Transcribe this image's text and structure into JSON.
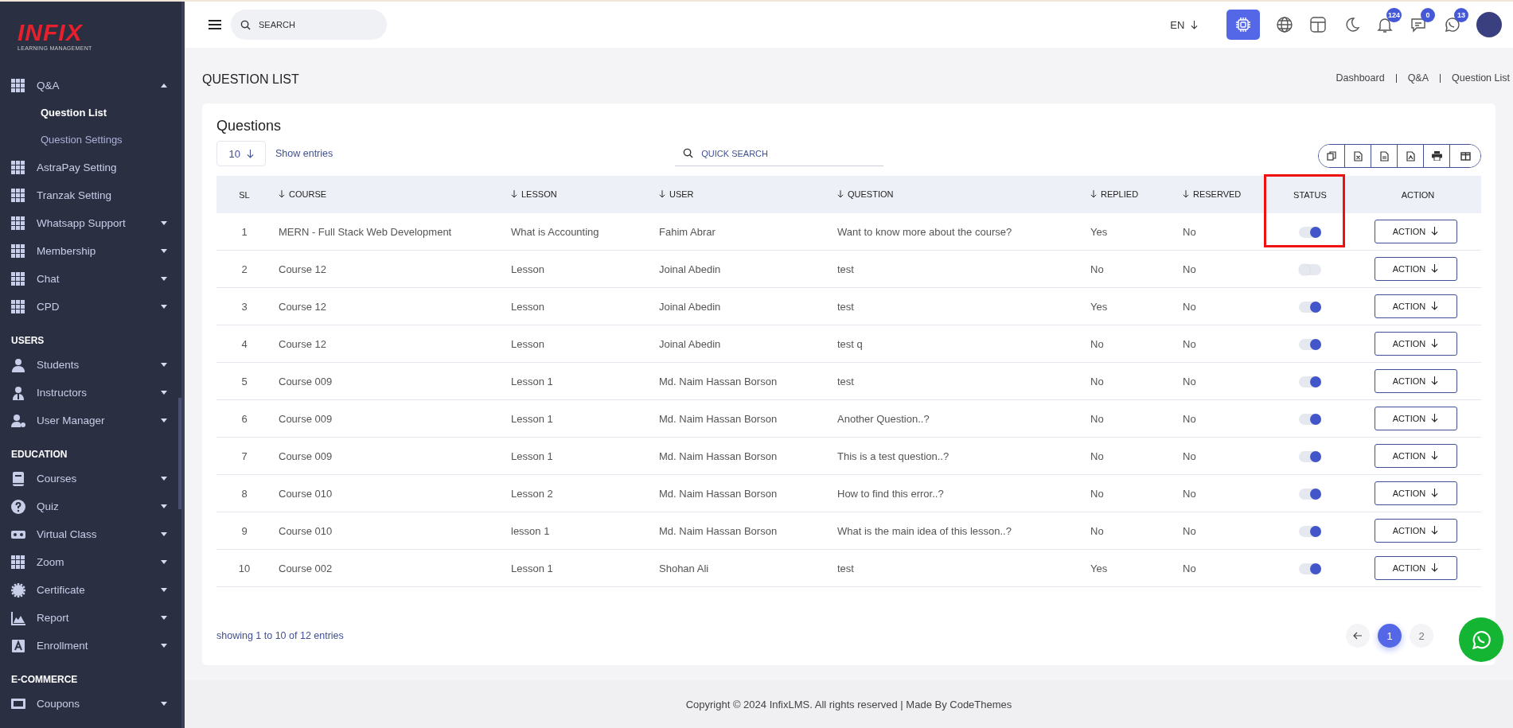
{
  "logo": {
    "text": "INFIX",
    "subtitle": "LEARNING MANAGEMENT"
  },
  "sidebar": {
    "sections": [
      {
        "items": [
          {
            "label": "Q&A",
            "kind": "grid",
            "expanded": true,
            "children": [
              {
                "label": "Question List",
                "selected": true
              },
              {
                "label": "Question Settings",
                "selected": false
              }
            ]
          },
          {
            "label": "AstraPay Setting",
            "kind": "grid"
          },
          {
            "label": "Tranzak Setting",
            "kind": "grid"
          },
          {
            "label": "Whatsapp Support",
            "kind": "grid",
            "expanded": false
          },
          {
            "label": "Membership",
            "kind": "grid",
            "expanded": false
          },
          {
            "label": "Chat",
            "kind": "grid",
            "expanded": false
          },
          {
            "label": "CPD",
            "kind": "grid",
            "expanded": false
          }
        ]
      },
      {
        "heading": "USERS",
        "items": [
          {
            "label": "Students",
            "kind": "user",
            "expanded": false
          },
          {
            "label": "Instructors",
            "kind": "instructor",
            "expanded": false
          },
          {
            "label": "User Manager",
            "kind": "usergear",
            "expanded": false
          }
        ]
      },
      {
        "heading": "EDUCATION",
        "items": [
          {
            "label": "Courses",
            "kind": "book",
            "expanded": false
          },
          {
            "label": "Quiz",
            "kind": "question",
            "expanded": false
          },
          {
            "label": "Virtual Class",
            "kind": "vr",
            "expanded": false
          },
          {
            "label": "Zoom",
            "kind": "grid",
            "expanded": false
          },
          {
            "label": "Certificate",
            "kind": "badge",
            "expanded": false
          },
          {
            "label": "Report",
            "kind": "chart",
            "expanded": false
          },
          {
            "label": "Enrollment",
            "kind": "letter",
            "expanded": false
          }
        ]
      },
      {
        "heading": "E-COMMERCE",
        "items": [
          {
            "label": "Coupons",
            "kind": "screen",
            "expanded": false
          }
        ]
      }
    ]
  },
  "header": {
    "search_placeholder": "SEARCH",
    "language": "EN",
    "notifications": "124",
    "messages": "0",
    "whatsapp": "13"
  },
  "page_title": "QUESTION LIST",
  "breadcrumb": [
    "Dashboard",
    "Q&A",
    "Question List"
  ],
  "card": {
    "title": "Questions",
    "page_size": "10",
    "show_entries": "Show entries",
    "quick_search_placeholder": "QUICK SEARCH"
  },
  "table": {
    "status_highlighted": true,
    "columns": [
      {
        "label": "SL",
        "sortable": false
      },
      {
        "label": "COURSE",
        "sortable": true
      },
      {
        "label": "LESSON",
        "sortable": true
      },
      {
        "label": "USER",
        "sortable": true
      },
      {
        "label": "QUESTION",
        "sortable": true
      },
      {
        "label": "REPLIED",
        "sortable": true
      },
      {
        "label": "RESERVED",
        "sortable": true
      },
      {
        "label": "STATUS",
        "sortable": false
      },
      {
        "label": "ACTION",
        "sortable": false
      }
    ],
    "rows": [
      {
        "sl": "1",
        "course": "MERN - Full Stack Web Development",
        "lesson": "What is Accounting",
        "user": "Fahim Abrar",
        "question": "Want to know more about the course?",
        "replied": "Yes",
        "reserved": "No",
        "status": true,
        "action": "ACTION"
      },
      {
        "sl": "2",
        "course": "Course 12",
        "lesson": "Lesson",
        "user": "Joinal Abedin",
        "question": "test",
        "replied": "No",
        "reserved": "No",
        "status": false,
        "action": "ACTION"
      },
      {
        "sl": "3",
        "course": "Course 12",
        "lesson": "Lesson",
        "user": "Joinal Abedin",
        "question": "test",
        "replied": "Yes",
        "reserved": "No",
        "status": true,
        "action": "ACTION"
      },
      {
        "sl": "4",
        "course": "Course 12",
        "lesson": "Lesson",
        "user": "Joinal Abedin",
        "question": "test q",
        "replied": "No",
        "reserved": "No",
        "status": true,
        "action": "ACTION"
      },
      {
        "sl": "5",
        "course": "Course 009",
        "lesson": "Lesson 1",
        "user": "Md. Naim Hassan Borson",
        "question": "test",
        "replied": "No",
        "reserved": "No",
        "status": true,
        "action": "ACTION"
      },
      {
        "sl": "6",
        "course": "Course 009",
        "lesson": "Lesson 1",
        "user": "Md. Naim Hassan Borson",
        "question": "Another Question..?",
        "replied": "No",
        "reserved": "No",
        "status": true,
        "action": "ACTION"
      },
      {
        "sl": "7",
        "course": "Course 009",
        "lesson": "Lesson 1",
        "user": "Md. Naim Hassan Borson",
        "question": "This is a test question..?",
        "replied": "No",
        "reserved": "No",
        "status": true,
        "action": "ACTION"
      },
      {
        "sl": "8",
        "course": "Course 010",
        "lesson": "Lesson 2",
        "user": "Md. Naim Hassan Borson",
        "question": "How to find this error..?",
        "replied": "No",
        "reserved": "No",
        "status": true,
        "action": "ACTION"
      },
      {
        "sl": "9",
        "course": "Course 010",
        "lesson": "lesson 1",
        "user": "Md. Naim Hassan Borson",
        "question": "What is the main idea of this lesson..?",
        "replied": "No",
        "reserved": "No",
        "status": true,
        "action": "ACTION"
      },
      {
        "sl": "10",
        "course": "Course 002",
        "lesson": "Lesson 1",
        "user": "Shohan Ali",
        "question": "test",
        "replied": "Yes",
        "reserved": "No",
        "status": true,
        "action": "ACTION"
      }
    ]
  },
  "entries_info": "showing 1 to 10 of 12 entries",
  "pagination": [
    {
      "label": "1",
      "selected": true
    },
    {
      "label": "2",
      "selected": false
    }
  ],
  "copyright": "Copyright © 2024 InfixLMS. All rights reserved | Made By CodeThemes"
}
